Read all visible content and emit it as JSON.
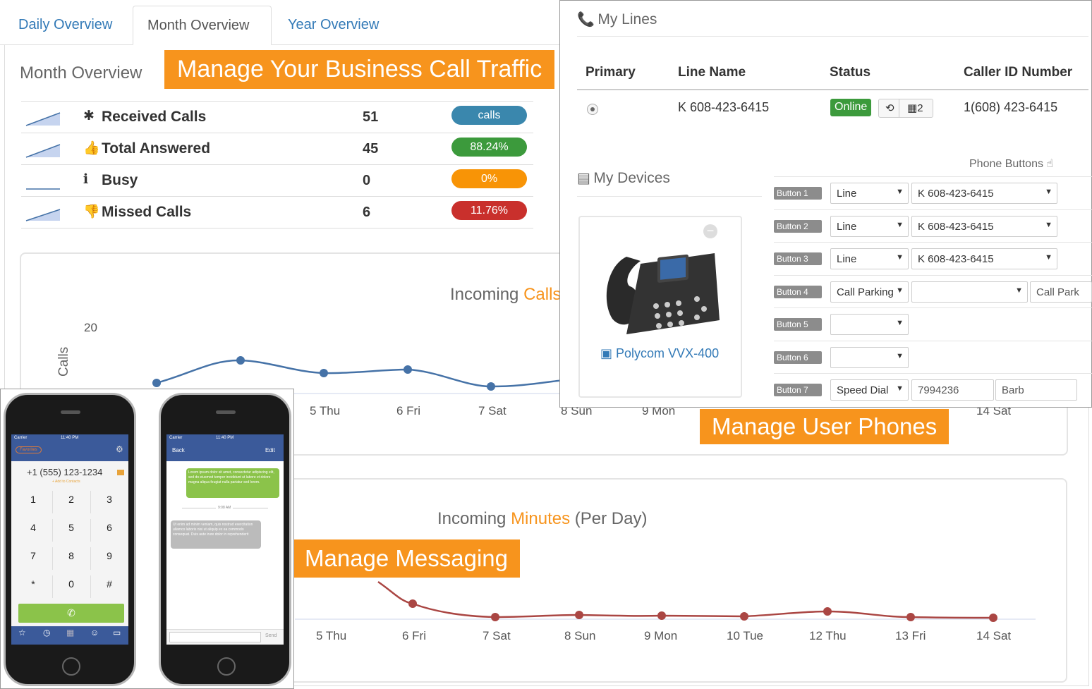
{
  "tabs": [
    "Daily Overview",
    "Month Overview",
    "Year Overview"
  ],
  "month_overview_title": "Month Overview",
  "callouts": {
    "traffic": "Manage Your Business Call Traffic",
    "phones": "Manage User Phones",
    "messaging": "Manage Messaging"
  },
  "stats": [
    {
      "icon": "asterisk-icon",
      "glyph": "✱",
      "label": "Received Calls",
      "value": "51",
      "badge": "calls",
      "color": "#3a87ad"
    },
    {
      "icon": "thumbs-up-icon",
      "glyph": "👍",
      "label": "Total Answered",
      "value": "45",
      "badge": "88.24%",
      "color": "#3c9a3c"
    },
    {
      "icon": "info-icon",
      "glyph": "ℹ",
      "label": "Busy",
      "value": "0",
      "badge": "0%",
      "color": "#f89406"
    },
    {
      "icon": "thumbs-down-icon",
      "glyph": "👎",
      "label": "Missed Calls",
      "value": "6",
      "badge": "11.76%",
      "color": "#c9302c"
    }
  ],
  "calls_chart": {
    "title_prefix": "Incoming ",
    "title_highlight": "Calls",
    "ylabel": "Calls",
    "ytick": "20",
    "x_labels": [
      "5 Thu",
      "6 Fri",
      "7 Sat",
      "8 Sun",
      "9 Mon",
      "14 Sat"
    ]
  },
  "minutes_chart": {
    "title_prefix": "Incoming ",
    "title_highlight": "Minutes",
    "title_suffix": " (Per Day)",
    "x_labels": [
      "5 Thu",
      "6 Fri",
      "7 Sat",
      "8 Sun",
      "9 Mon",
      "10 Tue",
      "12 Thu",
      "13 Fri",
      "14 Sat"
    ]
  },
  "my_lines": {
    "title": "My Lines",
    "headers": [
      "Primary",
      "Line Name",
      "Status",
      "Caller ID Number"
    ],
    "row": {
      "line_name": "K 608-423-6415",
      "status": "Online",
      "count": "2",
      "caller_id": "1(608) 423-6415"
    }
  },
  "my_devices": {
    "title": "My Devices",
    "device_name": "Polycom VVX-400",
    "phone_buttons_label": "Phone Buttons",
    "buttons": [
      {
        "label": "Button 1",
        "type": "Line",
        "value": "K 608-423-6415",
        "extra": ""
      },
      {
        "label": "Button 2",
        "type": "Line",
        "value": "K 608-423-6415",
        "extra": ""
      },
      {
        "label": "Button 3",
        "type": "Line",
        "value": "K 608-423-6415",
        "extra": ""
      },
      {
        "label": "Button 4",
        "type": "Call Parking",
        "value": "",
        "extra": "Call Park"
      },
      {
        "label": "Button 5",
        "type": "",
        "value": "",
        "extra": ""
      },
      {
        "label": "Button 6",
        "type": "",
        "value": "",
        "extra": ""
      },
      {
        "label": "Button 7",
        "type": "Speed Dial",
        "value": "7994236",
        "extra": "Barb"
      }
    ]
  },
  "dialer": {
    "carrier": "Carrier",
    "time": "11:40 PM",
    "tag": "Favorites",
    "number": "+1 (555) 123-1234",
    "add_link": "+ Add to Contacts",
    "keys": [
      "1",
      "2",
      "3",
      "4",
      "5",
      "6",
      "7",
      "8",
      "9",
      "*",
      "0",
      "#"
    ],
    "tab_labels": [
      "Quickdial",
      "History",
      "Keypad",
      "Contacts",
      "Messages"
    ]
  },
  "messaging": {
    "carrier": "Carrier",
    "time": "11:40 PM",
    "back": "Back",
    "edit": "Edit",
    "msg1": "Lorem ipsum dolor sit amet, consectetur adipiscing elit, sed do eiusmod tempor incididunt ut labore et dolore magna aliqua feugiat nulla pariatur sed lorem.",
    "divider": "9:08 AM",
    "msg2": "Ut enim ad minim veniam, quis nostrud exercitation ullamco laboris nisi ut aliquip ex ea commodo consequat. Duis aute irure dolor in reprehenderit",
    "send": "Send"
  }
}
